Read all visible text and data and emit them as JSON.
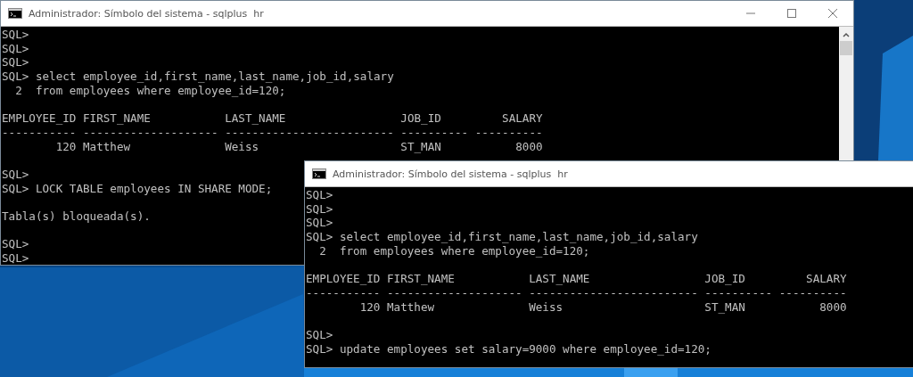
{
  "windows": [
    {
      "title": "Administrador: Símbolo del sistema - sqlplus  hr",
      "kind": "back",
      "blocks": [
        [
          "SQL>",
          "SQL>",
          "SQL>",
          "SQL> select employee_id,first_name,last_name,job_id,salary",
          "  2  from employees where employee_id=120;"
        ],
        [
          "EMPLOYEE_ID FIRST_NAME           LAST_NAME                 JOB_ID         SALARY",
          "----------- -------------------- ------------------------- ---------- ----------",
          "        120 Matthew              Weiss                     ST_MAN           8000"
        ],
        [
          "SQL>",
          "SQL> LOCK TABLE employees IN SHARE MODE;"
        ],
        [
          "Tabla(s) bloqueada(s)."
        ],
        [
          "SQL>",
          "SQL>"
        ]
      ]
    },
    {
      "title": "Administrador: Símbolo del sistema - sqlplus  hr",
      "kind": "front",
      "blocks": [
        [
          "SQL>",
          "SQL>",
          "SQL>",
          "SQL> select employee_id,first_name,last_name,job_id,salary",
          "  2  from employees where employee_id=120;"
        ],
        [
          "EMPLOYEE_ID FIRST_NAME           LAST_NAME                 JOB_ID         SALARY",
          "----------- -------------------- ------------------------- ---------- ----------",
          "        120 Matthew              Weiss                     ST_MAN           8000"
        ],
        [
          "SQL>",
          "SQL> update employees set salary=9000 where employee_id=120;"
        ]
      ]
    }
  ]
}
